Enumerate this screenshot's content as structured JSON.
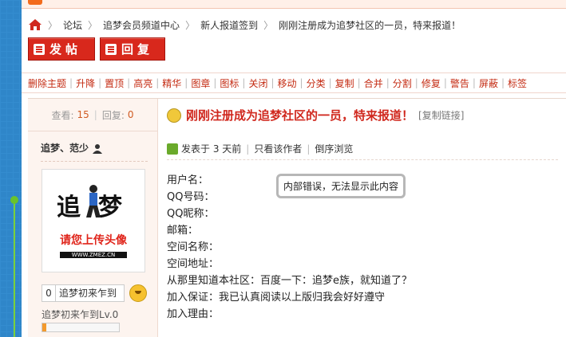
{
  "breadcrumb": [
    "论坛",
    "追梦会员频道中心",
    "新人报道签到",
    "刚刚注册成为追梦社区的一员，特来报道！"
  ],
  "buttons": {
    "post": "发帖",
    "reply": "回复"
  },
  "admin_actions": [
    "删除主题",
    "升降",
    "置顶",
    "高亮",
    "精华",
    "图章",
    "图标",
    "关闭",
    "移动",
    "分类",
    "复制",
    "合并",
    "分割",
    "修复",
    "警告",
    "屏蔽",
    "标签"
  ],
  "stats": {
    "views_label": "查看:",
    "views": "15",
    "replies_label": "回复:",
    "replies": "0"
  },
  "author": "追梦、范少",
  "avatar": {
    "title": "追梦",
    "subtitle": "请您上传头像",
    "url": "WWW.ZMEZ.CN"
  },
  "rank": {
    "number": "0",
    "title": "追梦初来乍到",
    "level": "追梦初来乍到Lv.0",
    "progress": 0.05
  },
  "thread": {
    "title": "刚刚注册成为追梦社区的一员，特来报道！",
    "copy_link": "[复制链接]"
  },
  "meta": {
    "posted": "发表于 3 天前",
    "only_author": "只看该作者",
    "reverse": "倒序浏览"
  },
  "fields": [
    "用户名：",
    "QQ号码：",
    "QQ昵称：",
    "邮箱：",
    "空间名称：",
    "空间地址：",
    "从那里知道本社区：百度一下：追梦e族，就知道了？",
    "加入保证：我已认真阅读以上版归我会好好遵守",
    "加入理由："
  ],
  "error_message": "内部错误，无法显示此内容",
  "colors": {
    "accent": "#d0281e",
    "link": "#c42b12",
    "left_strip": "#2f86c9"
  }
}
